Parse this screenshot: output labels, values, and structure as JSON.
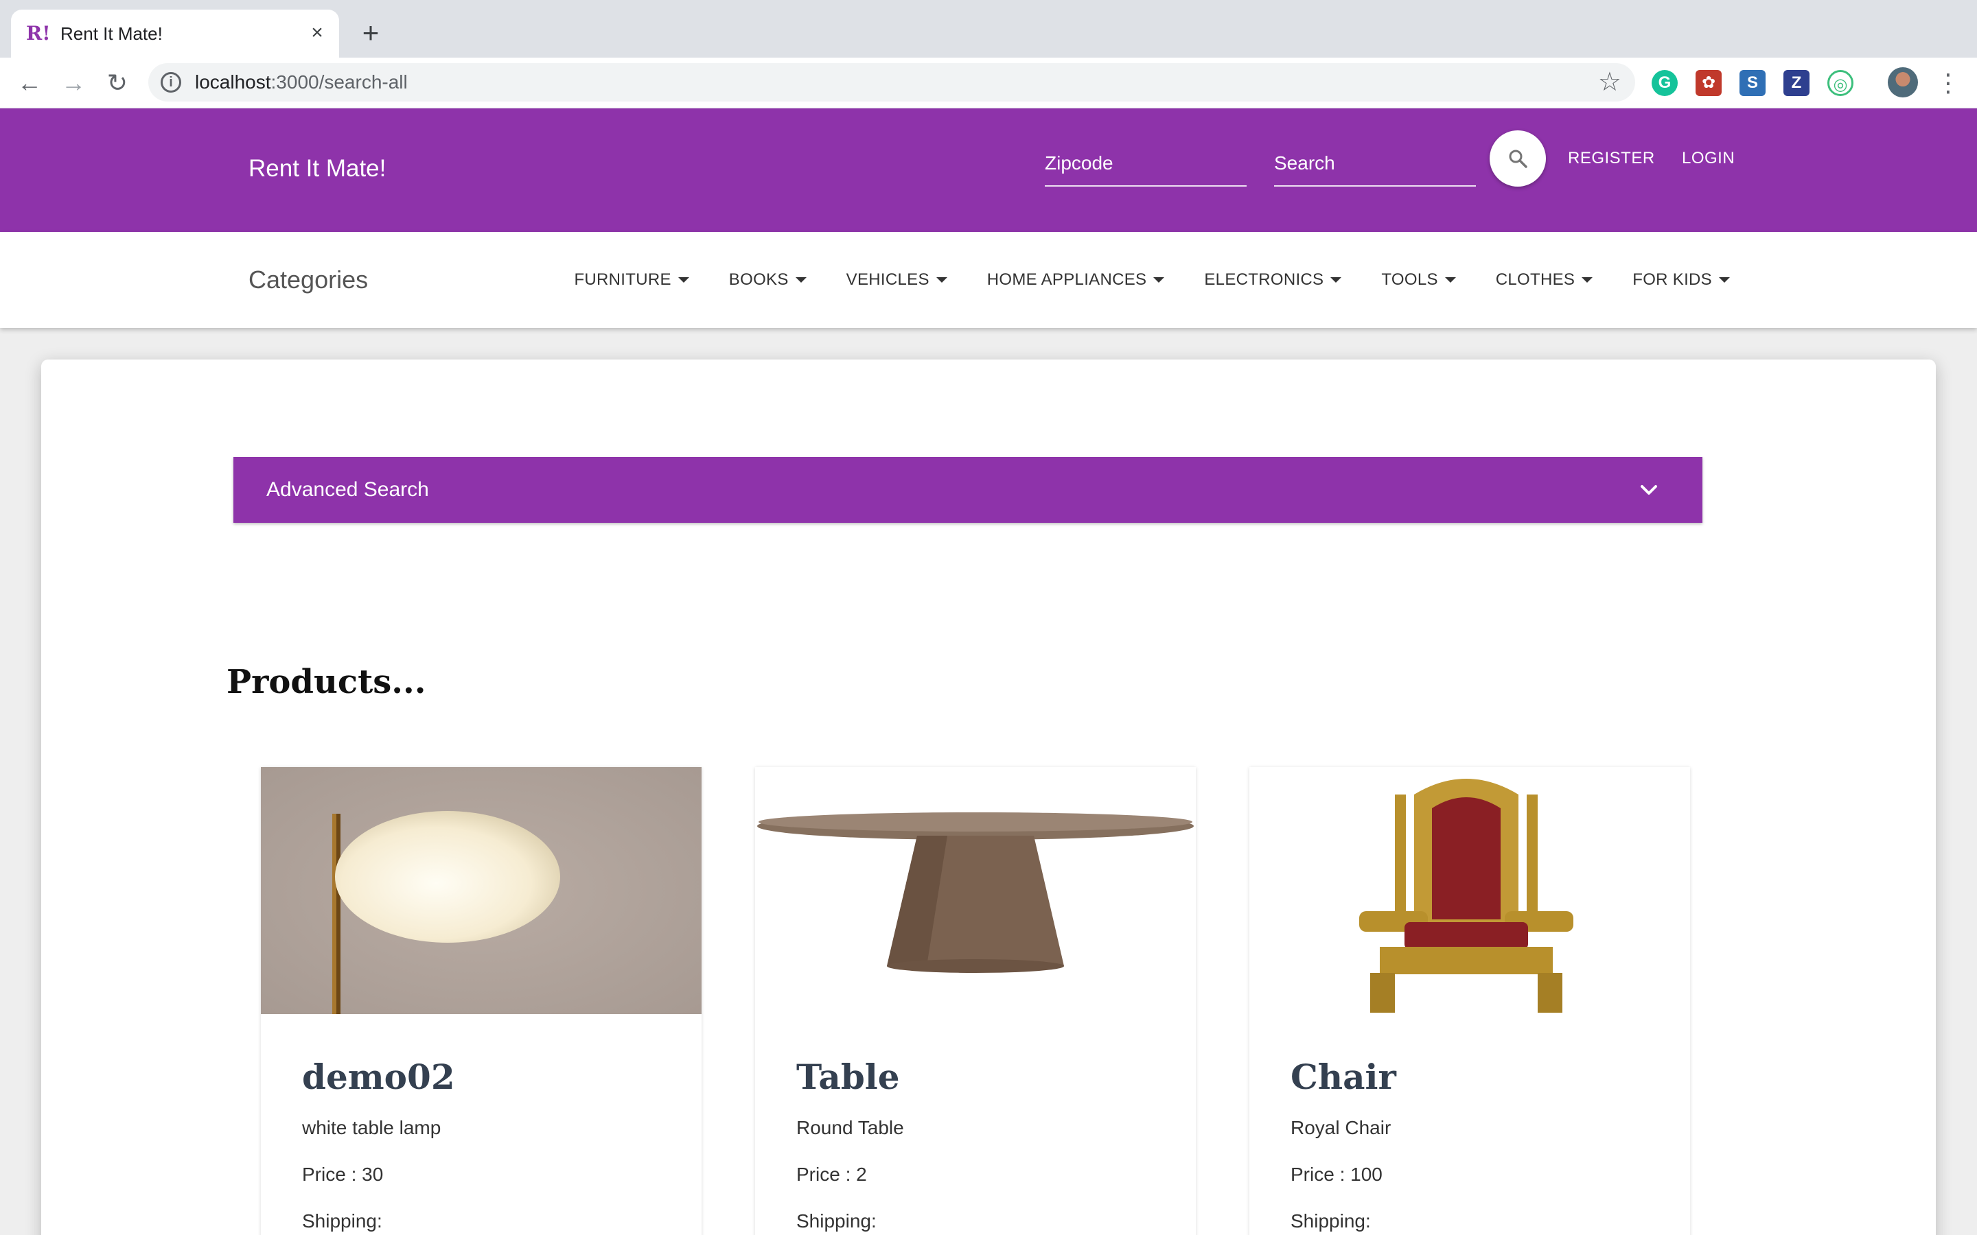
{
  "browser": {
    "tab_title": "Rent It Mate!",
    "favicon_text": "R!",
    "url_host": "localhost",
    "url_path": ":3000/search-all"
  },
  "header": {
    "brand": "Rent It Mate!",
    "zipcode_placeholder": "Zipcode",
    "search_placeholder": "Search",
    "register_label": "REGISTER",
    "login_label": "LOGIN",
    "accent_color": "#8e33aa"
  },
  "categories": {
    "title": "Categories",
    "items": [
      {
        "label": "FURNITURE"
      },
      {
        "label": "BOOKS"
      },
      {
        "label": "VEHICLES"
      },
      {
        "label": "HOME APPLIANCES"
      },
      {
        "label": "ELECTRONICS"
      },
      {
        "label": "TOOLS"
      },
      {
        "label": "CLOTHES"
      },
      {
        "label": "FOR KIDS"
      }
    ]
  },
  "main": {
    "advanced_search_label": "Advanced Search",
    "products_title": "Products...",
    "products": [
      {
        "name": "demo02",
        "description": "white table lamp",
        "price": "Price : 30",
        "shipping": "Shipping:",
        "image": "lamp"
      },
      {
        "name": "Table",
        "description": "Round Table",
        "price": "Price : 2",
        "shipping": "Shipping:",
        "image": "table"
      },
      {
        "name": "Chair",
        "description": "Royal Chair",
        "price": "Price : 100",
        "shipping": "Shipping:",
        "image": "chair"
      }
    ]
  }
}
